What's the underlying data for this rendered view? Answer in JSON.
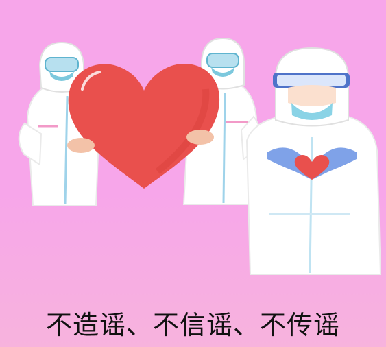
{
  "poster": {
    "slogan": "不造谣、不信谣、不传谣"
  },
  "colors": {
    "background": "#f7a6ea",
    "heart": "#e9504d",
    "suit": "#ffffff",
    "mask": "#8ad3e6",
    "gloves": "#7fa2e8"
  },
  "icons": {
    "big_heart": "heart-icon",
    "small_heart": "heart-icon"
  }
}
